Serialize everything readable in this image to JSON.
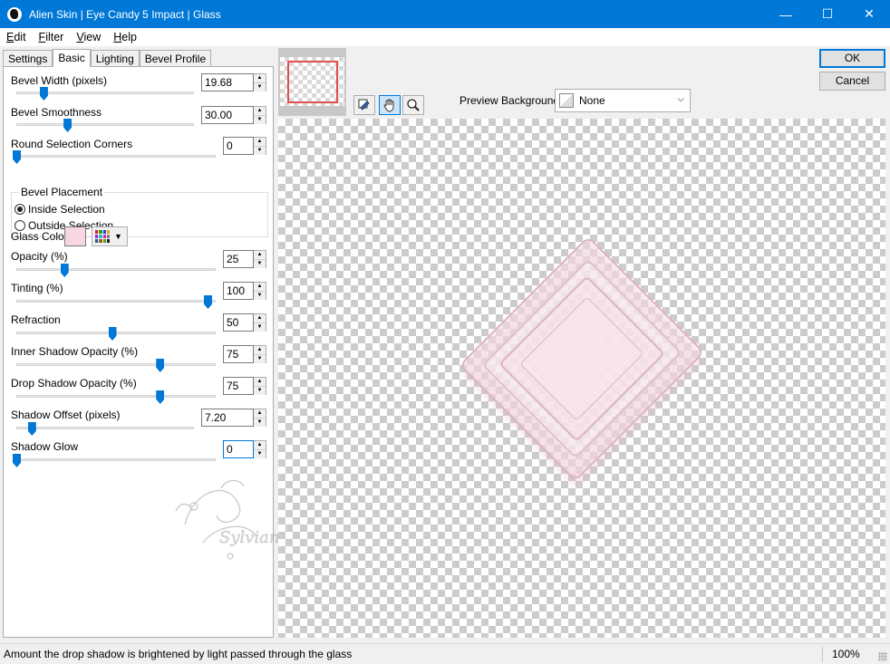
{
  "window": {
    "title": "Alien Skin | Eye Candy 5 Impact | Glass",
    "minimize_glyph": "—",
    "maximize_glyph": "☐",
    "close_glyph": "✕"
  },
  "menu": [
    {
      "label": "Edit",
      "accel": "E",
      "rest": "dit"
    },
    {
      "label": "Filter",
      "accel": "F",
      "rest": "ilter"
    },
    {
      "label": "View",
      "accel": "V",
      "rest": "iew"
    },
    {
      "label": "Help",
      "accel": "H",
      "rest": "elp"
    }
  ],
  "tabs": [
    "Settings",
    "Basic",
    "Lighting",
    "Bevel Profile"
  ],
  "active_tab": "Basic",
  "controls": {
    "bevel_width": {
      "label": "Bevel Width (pixels)",
      "value": "19.68",
      "fraction": 0.16
    },
    "bevel_smoothness": {
      "label": "Bevel Smoothness",
      "value": "30.00",
      "fraction": 0.3
    },
    "round_corners": {
      "label": "Round Selection Corners",
      "value": "0",
      "fraction": 0.0
    },
    "opacity": {
      "label": "Opacity (%)",
      "value": "25",
      "fraction": 0.25
    },
    "tinting": {
      "label": "Tinting (%)",
      "value": "100",
      "fraction": 1.0
    },
    "refraction": {
      "label": "Refraction",
      "value": "50",
      "fraction": 0.5
    },
    "inner_shadow": {
      "label": "Inner Shadow Opacity (%)",
      "value": "75",
      "fraction": 0.75
    },
    "drop_shadow": {
      "label": "Drop Shadow Opacity (%)",
      "value": "75",
      "fraction": 0.75
    },
    "shadow_offset": {
      "label": "Shadow Offset (pixels)",
      "value": "7.20",
      "fraction": 0.09
    },
    "shadow_glow": {
      "label": "Shadow Glow",
      "value": "0",
      "fraction": 0.0
    }
  },
  "bevel_placement": {
    "legend": "Bevel Placement",
    "options": [
      "Inside Selection",
      "Outside Selection"
    ],
    "selected": "Inside Selection"
  },
  "glass_color": {
    "label": "Glass Color",
    "color": "#f8d7e2"
  },
  "watermark_text": "Sylviane",
  "preview_background": {
    "label": "Preview Background:",
    "value": "None"
  },
  "tools": [
    "eyedropper-icon",
    "hand-icon",
    "zoom-icon"
  ],
  "buttons": {
    "ok": "OK",
    "cancel": "Cancel"
  },
  "status": {
    "message": "Amount the drop shadow is brightened by light passed through the glass",
    "zoom": "100%"
  },
  "colors": {
    "accent": "#0078d7",
    "glass": "#f4dce4"
  }
}
